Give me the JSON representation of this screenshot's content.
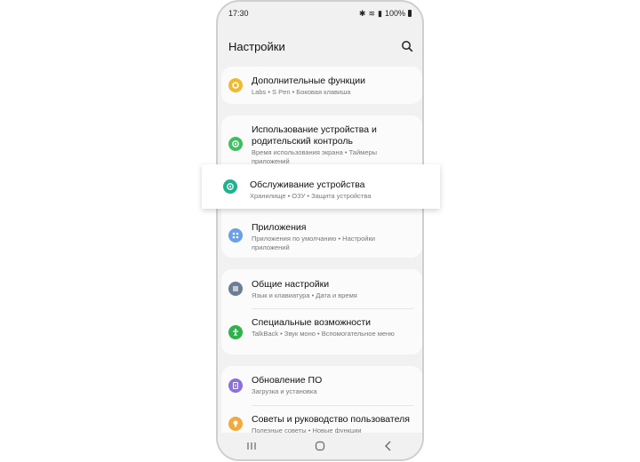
{
  "status_bar": {
    "time": "17:30",
    "battery": "100%"
  },
  "header": {
    "title": "Настройки"
  },
  "items": [
    {
      "title": "Дополнительные функции",
      "subtitle": "Labs  •  S Pen  •  Боковая клавиша",
      "icon": "star-gear-icon",
      "color": "#f2b92e"
    },
    {
      "title": "Использование устройства и родительский контроль",
      "subtitle": "Время использования экрана  •  Таймеры приложений",
      "icon": "digital-wellbeing-icon",
      "color": "#3fbf5f"
    },
    {
      "title": "Обслуживание устройства",
      "subtitle": "Хранилище  •  ОЗУ  •  Защита устройства",
      "icon": "device-care-icon",
      "color": "#1db38f"
    },
    {
      "title": "Приложения",
      "subtitle": "Приложения по умолчанию  •  Настройки приложений",
      "icon": "apps-icon",
      "color": "#6aa0e8"
    },
    {
      "title": "Общие настройки",
      "subtitle": "Язык и клавиатура  •  Дата и время",
      "icon": "sliders-icon",
      "color": "#6b7f94"
    },
    {
      "title": "Специальные возможности",
      "subtitle": "TalkBack  •  Звук моно  •  Вспомогательное меню",
      "icon": "accessibility-icon",
      "color": "#2db34a"
    },
    {
      "title": "Обновление ПО",
      "subtitle": "Загрузка и установка",
      "icon": "software-update-icon",
      "color": "#8a6fe0"
    },
    {
      "title": "Советы и руководство пользователя",
      "subtitle": "Полезные советы  •  Новые функции",
      "icon": "tips-bulb-icon",
      "color": "#f2a93e"
    }
  ]
}
